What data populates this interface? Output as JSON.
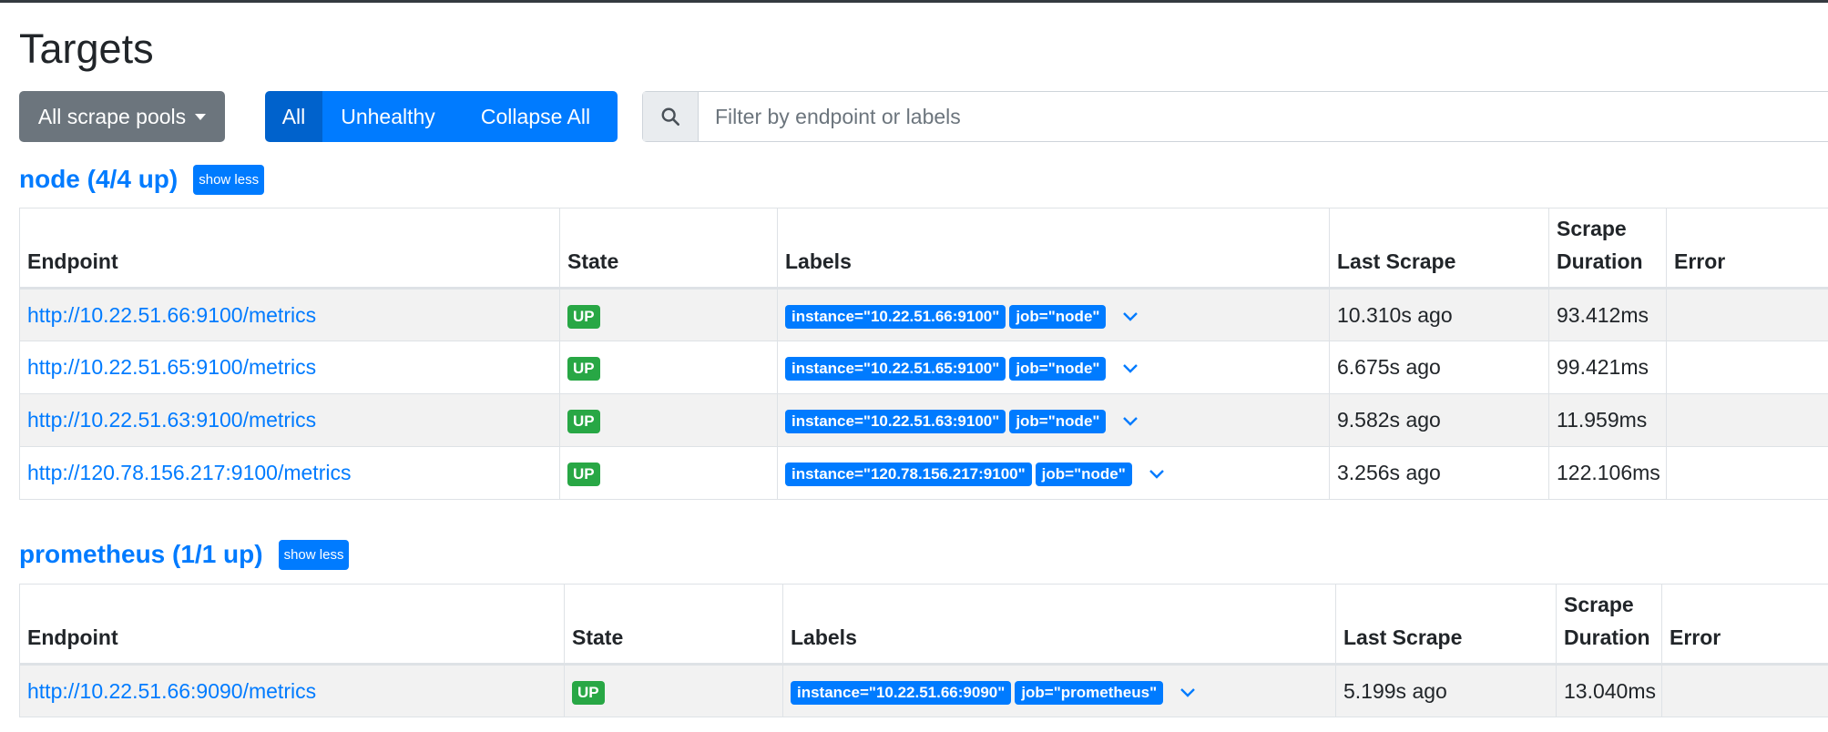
{
  "header": {
    "title": "Targets"
  },
  "toolbar": {
    "scrape_pools_label": "All scrape pools",
    "filter_all": "All",
    "filter_unhealthy": "Unhealthy",
    "collapse_all": "Collapse All",
    "search_placeholder": "Filter by endpoint or labels"
  },
  "columns": {
    "endpoint": "Endpoint",
    "state": "State",
    "labels": "Labels",
    "last_scrape": "Last Scrape",
    "scrape_duration": "Scrape Duration",
    "error": "Error"
  },
  "pools": [
    {
      "title": "node (4/4 up)",
      "toggle": "show less",
      "rows": [
        {
          "endpoint": "http://10.22.51.66:9100/metrics",
          "state": "UP",
          "instance": "instance=\"10.22.51.66:9100\"",
          "job": "job=\"node\"",
          "last_scrape": "10.310s ago",
          "duration": "93.412ms",
          "error": ""
        },
        {
          "endpoint": "http://10.22.51.65:9100/metrics",
          "state": "UP",
          "instance": "instance=\"10.22.51.65:9100\"",
          "job": "job=\"node\"",
          "last_scrape": "6.675s ago",
          "duration": "99.421ms",
          "error": ""
        },
        {
          "endpoint": "http://10.22.51.63:9100/metrics",
          "state": "UP",
          "instance": "instance=\"10.22.51.63:9100\"",
          "job": "job=\"node\"",
          "last_scrape": "9.582s ago",
          "duration": "11.959ms",
          "error": ""
        },
        {
          "endpoint": "http://120.78.156.217:9100/metrics",
          "state": "UP",
          "instance": "instance=\"120.78.156.217:9100\"",
          "job": "job=\"node\"",
          "last_scrape": "3.256s ago",
          "duration": "122.106ms",
          "error": ""
        }
      ]
    },
    {
      "title": "prometheus (1/1 up)",
      "toggle": "show less",
      "rows": [
        {
          "endpoint": "http://10.22.51.66:9090/metrics",
          "state": "UP",
          "instance": "instance=\"10.22.51.66:9090\"",
          "job": "job=\"prometheus\"",
          "last_scrape": "5.199s ago",
          "duration": "13.040ms",
          "error": ""
        }
      ]
    }
  ],
  "colors": {
    "primary": "#007bff",
    "success": "#28a745",
    "secondary": "#6c757d"
  },
  "icons": {
    "search": "search-icon",
    "expand": "chevron-down-icon"
  }
}
